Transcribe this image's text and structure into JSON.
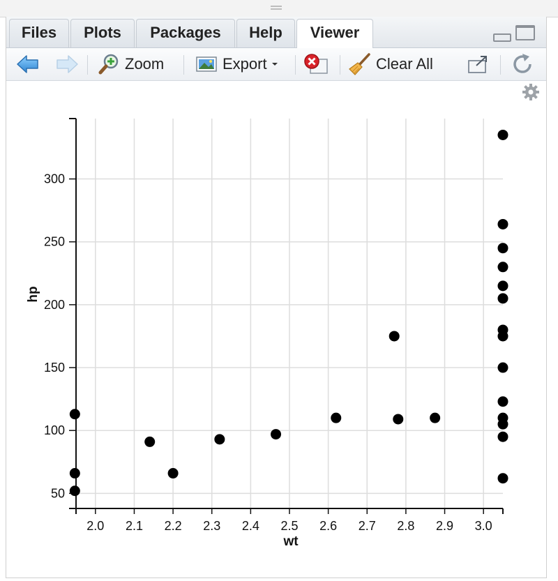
{
  "tabs": [
    {
      "label": "Files",
      "active": false
    },
    {
      "label": "Plots",
      "active": false
    },
    {
      "label": "Packages",
      "active": false
    },
    {
      "label": "Help",
      "active": false
    },
    {
      "label": "Viewer",
      "active": true
    }
  ],
  "toolbar": {
    "back_icon": "arrow-left-icon",
    "forward_icon": "arrow-right-icon",
    "zoom_label": "Zoom",
    "zoom_icon": "magnifier-plus-icon",
    "export_label": "Export",
    "export_icon": "picture-export-icon",
    "remove_icon": "remove-viewer-icon",
    "clear_label": "Clear All",
    "clear_icon": "broom-icon",
    "popout_icon": "popout-window-icon",
    "refresh_icon": "refresh-icon"
  },
  "viewer": {
    "gear_icon": "gear-icon"
  },
  "colors": {
    "points": "#000000",
    "grid": "#dddddd",
    "accent_blue": "#3a8fd6"
  },
  "chart_data": {
    "type": "scatter",
    "title": "",
    "xlabel": "wt",
    "ylabel": "hp",
    "xlim": [
      1.95,
      3.05
    ],
    "ylim": [
      38,
      348
    ],
    "xticks": [
      "2.0",
      "2.1",
      "2.2",
      "2.3",
      "2.4",
      "2.5",
      "2.6",
      "2.7",
      "2.8",
      "2.9",
      "3.0"
    ],
    "yticks": [
      "50",
      "100",
      "150",
      "200",
      "250",
      "300"
    ],
    "grid": true,
    "points": [
      {
        "x": 1.947,
        "y": 113
      },
      {
        "x": 1.947,
        "y": 66
      },
      {
        "x": 1.947,
        "y": 52
      },
      {
        "x": 2.14,
        "y": 91
      },
      {
        "x": 2.2,
        "y": 66
      },
      {
        "x": 2.32,
        "y": 93
      },
      {
        "x": 2.465,
        "y": 97
      },
      {
        "x": 2.62,
        "y": 110
      },
      {
        "x": 2.77,
        "y": 175
      },
      {
        "x": 2.78,
        "y": 109
      },
      {
        "x": 2.875,
        "y": 110
      },
      {
        "x": 3.05,
        "y": 335
      },
      {
        "x": 3.05,
        "y": 264
      },
      {
        "x": 3.05,
        "y": 245
      },
      {
        "x": 3.05,
        "y": 230
      },
      {
        "x": 3.05,
        "y": 215
      },
      {
        "x": 3.05,
        "y": 205
      },
      {
        "x": 3.05,
        "y": 180
      },
      {
        "x": 3.05,
        "y": 175
      },
      {
        "x": 3.05,
        "y": 150
      },
      {
        "x": 3.05,
        "y": 123
      },
      {
        "x": 3.05,
        "y": 110
      },
      {
        "x": 3.05,
        "y": 105
      },
      {
        "x": 3.05,
        "y": 95
      },
      {
        "x": 3.05,
        "y": 62
      }
    ]
  }
}
